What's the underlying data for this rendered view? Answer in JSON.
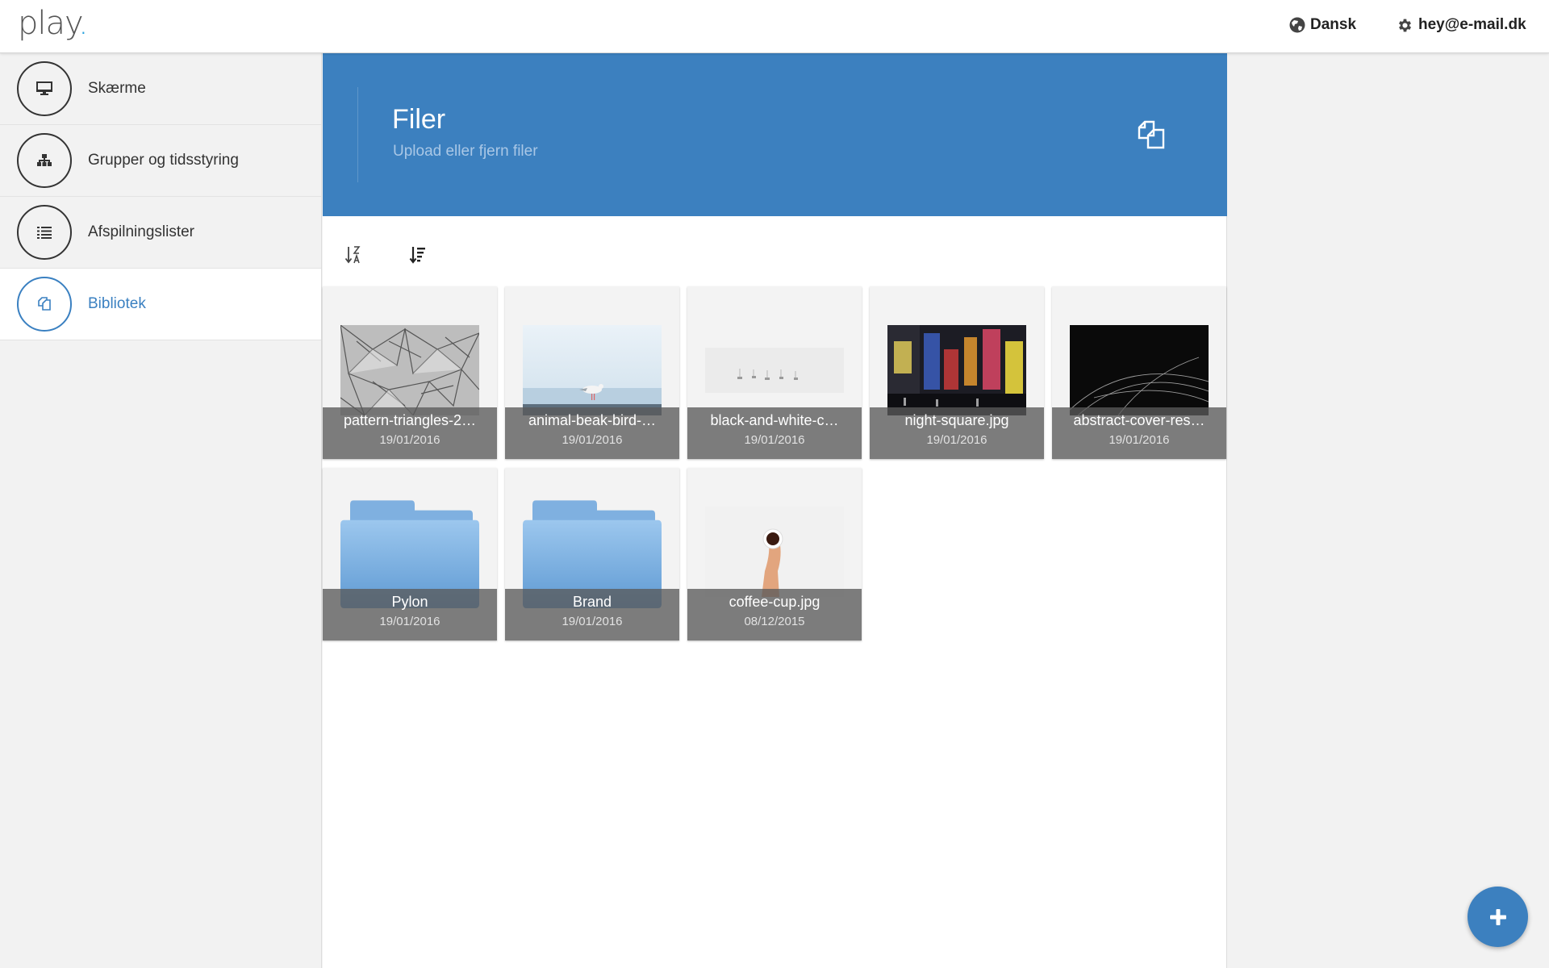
{
  "header": {
    "logo_text": "play",
    "logo_dot": ".",
    "language": "Dansk",
    "account": "hey@e-mail.dk",
    "icons": {
      "language": "globe-icon",
      "account": "gear-icon"
    }
  },
  "sidebar": {
    "items": [
      {
        "label": "Skærme",
        "icon": "monitor-icon",
        "active": false
      },
      {
        "label": "Grupper og tidsstyring",
        "icon": "hierarchy-icon",
        "active": false
      },
      {
        "label": "Afspilningslister",
        "icon": "list-icon",
        "active": false
      },
      {
        "label": "Bibliotek",
        "icon": "library-files-icon",
        "active": true
      }
    ]
  },
  "banner": {
    "title": "Filer",
    "subtitle": "Upload eller fjern filer",
    "icon": "files-copy-icon"
  },
  "toolbar": {
    "sort_alpha_icon": "sort-alpha-icon",
    "sort_list_icon": "sort-list-icon"
  },
  "files": [
    {
      "name": "pattern-triangles-2…",
      "date": "19/01/2016",
      "kind": "image",
      "thumb": "triangles"
    },
    {
      "name": "animal-beak-bird-…",
      "date": "19/01/2016",
      "kind": "image",
      "thumb": "seagull"
    },
    {
      "name": "black-and-white-c…",
      "date": "19/01/2016",
      "kind": "image",
      "thumb": "fog"
    },
    {
      "name": "night-square.jpg",
      "date": "19/01/2016",
      "kind": "image",
      "thumb": "night"
    },
    {
      "name": "abstract-cover-res…",
      "date": "19/01/2016",
      "kind": "image",
      "thumb": "abstract"
    },
    {
      "name": "Pylon",
      "date": "19/01/2016",
      "kind": "folder"
    },
    {
      "name": "Brand",
      "date": "19/01/2016",
      "kind": "folder"
    },
    {
      "name": "coffee-cup.jpg",
      "date": "08/12/2015",
      "kind": "image",
      "thumb": "coffee"
    }
  ],
  "colors": {
    "accent": "#3c80bf",
    "banner": "#3c80bf",
    "logo_dot": "#2aa3de"
  },
  "fab": {
    "icon": "plus-icon"
  }
}
